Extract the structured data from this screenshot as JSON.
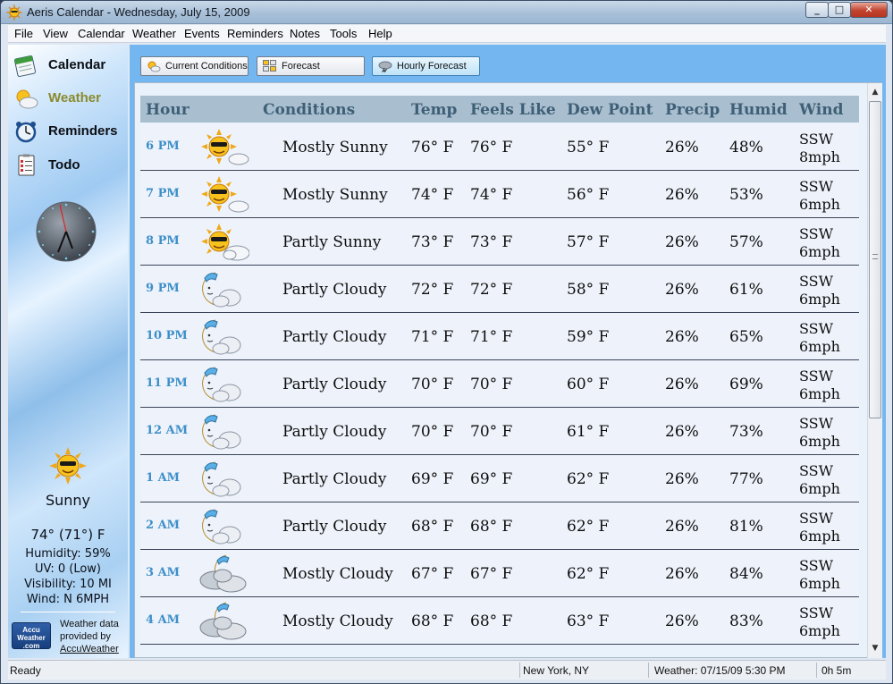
{
  "window": {
    "title": "Aeris Calendar - Wednesday, July 15, 2009"
  },
  "menu": [
    "File",
    "View",
    "Calendar",
    "Weather",
    "Events",
    "Reminders",
    "Notes",
    "Tools",
    "Help"
  ],
  "sidebar": {
    "nav": [
      {
        "label": "Calendar",
        "icon": "calendar-icon"
      },
      {
        "label": "Weather",
        "icon": "weather-icon",
        "active": true
      },
      {
        "label": "Reminders",
        "icon": "alarm-clock-icon"
      },
      {
        "label": "Todo",
        "icon": "todo-list-icon"
      }
    ],
    "current": {
      "icon": "sunny-sunglasses-icon",
      "condition": "Sunny",
      "temp": "74° (71°) F",
      "humidity": "Humidity: 59%",
      "uv": "UV: 0 (Low)",
      "visibility": "Visibility: 10 MI",
      "wind": "Wind: N 6MPH"
    },
    "credit": {
      "logo_line1": "Accu",
      "logo_line2": "Weather",
      "logo_line3": ".com",
      "line1": "Weather data",
      "line2": "provided by",
      "link": "AccuWeather"
    }
  },
  "toolbar": {
    "current_conditions": "Current Conditions",
    "forecast": "Forecast",
    "hourly_forecast": "Hourly Forecast"
  },
  "table": {
    "headers": [
      "Hour",
      "Conditions",
      "Temp",
      "Feels Like",
      "Dew Point",
      "Precip",
      "Humid",
      "Wind"
    ],
    "rows": [
      {
        "hour": "6 PM",
        "icon": "mostly-sunny-icon",
        "conditions": "Mostly Sunny",
        "temp": "76° F",
        "feels": "76° F",
        "dew": "55° F",
        "precip": "26%",
        "humid": "48%",
        "wind_dir": "SSW",
        "wind_speed": "8mph"
      },
      {
        "hour": "7 PM",
        "icon": "mostly-sunny-icon",
        "conditions": "Mostly Sunny",
        "temp": "74° F",
        "feels": "74° F",
        "dew": "56° F",
        "precip": "26%",
        "humid": "53%",
        "wind_dir": "SSW",
        "wind_speed": "6mph"
      },
      {
        "hour": "8 PM",
        "icon": "partly-sunny-icon",
        "conditions": "Partly Sunny",
        "temp": "73° F",
        "feels": "73° F",
        "dew": "57° F",
        "precip": "26%",
        "humid": "57%",
        "wind_dir": "SSW",
        "wind_speed": "6mph"
      },
      {
        "hour": "9 PM",
        "icon": "partly-cloudy-night-icon",
        "conditions": "Partly Cloudy",
        "temp": "72° F",
        "feels": "72° F",
        "dew": "58° F",
        "precip": "26%",
        "humid": "61%",
        "wind_dir": "SSW",
        "wind_speed": "6mph"
      },
      {
        "hour": "10 PM",
        "icon": "partly-cloudy-night-icon",
        "conditions": "Partly Cloudy",
        "temp": "71° F",
        "feels": "71° F",
        "dew": "59° F",
        "precip": "26%",
        "humid": "65%",
        "wind_dir": "SSW",
        "wind_speed": "6mph"
      },
      {
        "hour": "11 PM",
        "icon": "partly-cloudy-night-icon",
        "conditions": "Partly Cloudy",
        "temp": "70° F",
        "feels": "70° F",
        "dew": "60° F",
        "precip": "26%",
        "humid": "69%",
        "wind_dir": "SSW",
        "wind_speed": "6mph"
      },
      {
        "hour": "12 AM",
        "icon": "partly-cloudy-night-icon",
        "conditions": "Partly Cloudy",
        "temp": "70° F",
        "feels": "70° F",
        "dew": "61° F",
        "precip": "26%",
        "humid": "73%",
        "wind_dir": "SSW",
        "wind_speed": "6mph"
      },
      {
        "hour": "1 AM",
        "icon": "partly-cloudy-night-icon",
        "conditions": "Partly Cloudy",
        "temp": "69° F",
        "feels": "69° F",
        "dew": "62° F",
        "precip": "26%",
        "humid": "77%",
        "wind_dir": "SSW",
        "wind_speed": "6mph"
      },
      {
        "hour": "2 AM",
        "icon": "partly-cloudy-night-icon",
        "conditions": "Partly Cloudy",
        "temp": "68° F",
        "feels": "68° F",
        "dew": "62° F",
        "precip": "26%",
        "humid": "81%",
        "wind_dir": "SSW",
        "wind_speed": "6mph"
      },
      {
        "hour": "3 AM",
        "icon": "mostly-cloudy-night-icon",
        "conditions": "Mostly Cloudy",
        "temp": "67° F",
        "feels": "67° F",
        "dew": "62° F",
        "precip": "26%",
        "humid": "84%",
        "wind_dir": "SSW",
        "wind_speed": "6mph"
      },
      {
        "hour": "4 AM",
        "icon": "mostly-cloudy-night-icon",
        "conditions": "Mostly Cloudy",
        "temp": "68° F",
        "feels": "68° F",
        "dew": "63° F",
        "precip": "26%",
        "humid": "83%",
        "wind_dir": "SSW",
        "wind_speed": "6mph"
      }
    ]
  },
  "status": {
    "state": "Ready",
    "location": "New York, NY",
    "weather_time": "Weather: 07/15/09 5:30 PM",
    "elapsed": "0h 5m"
  },
  "colors": {
    "accent_blue": "#74b7f0",
    "header_bg": "#a9bfcf",
    "hour_text": "#3d8fc9",
    "active_nav": "#8a8a2c"
  }
}
